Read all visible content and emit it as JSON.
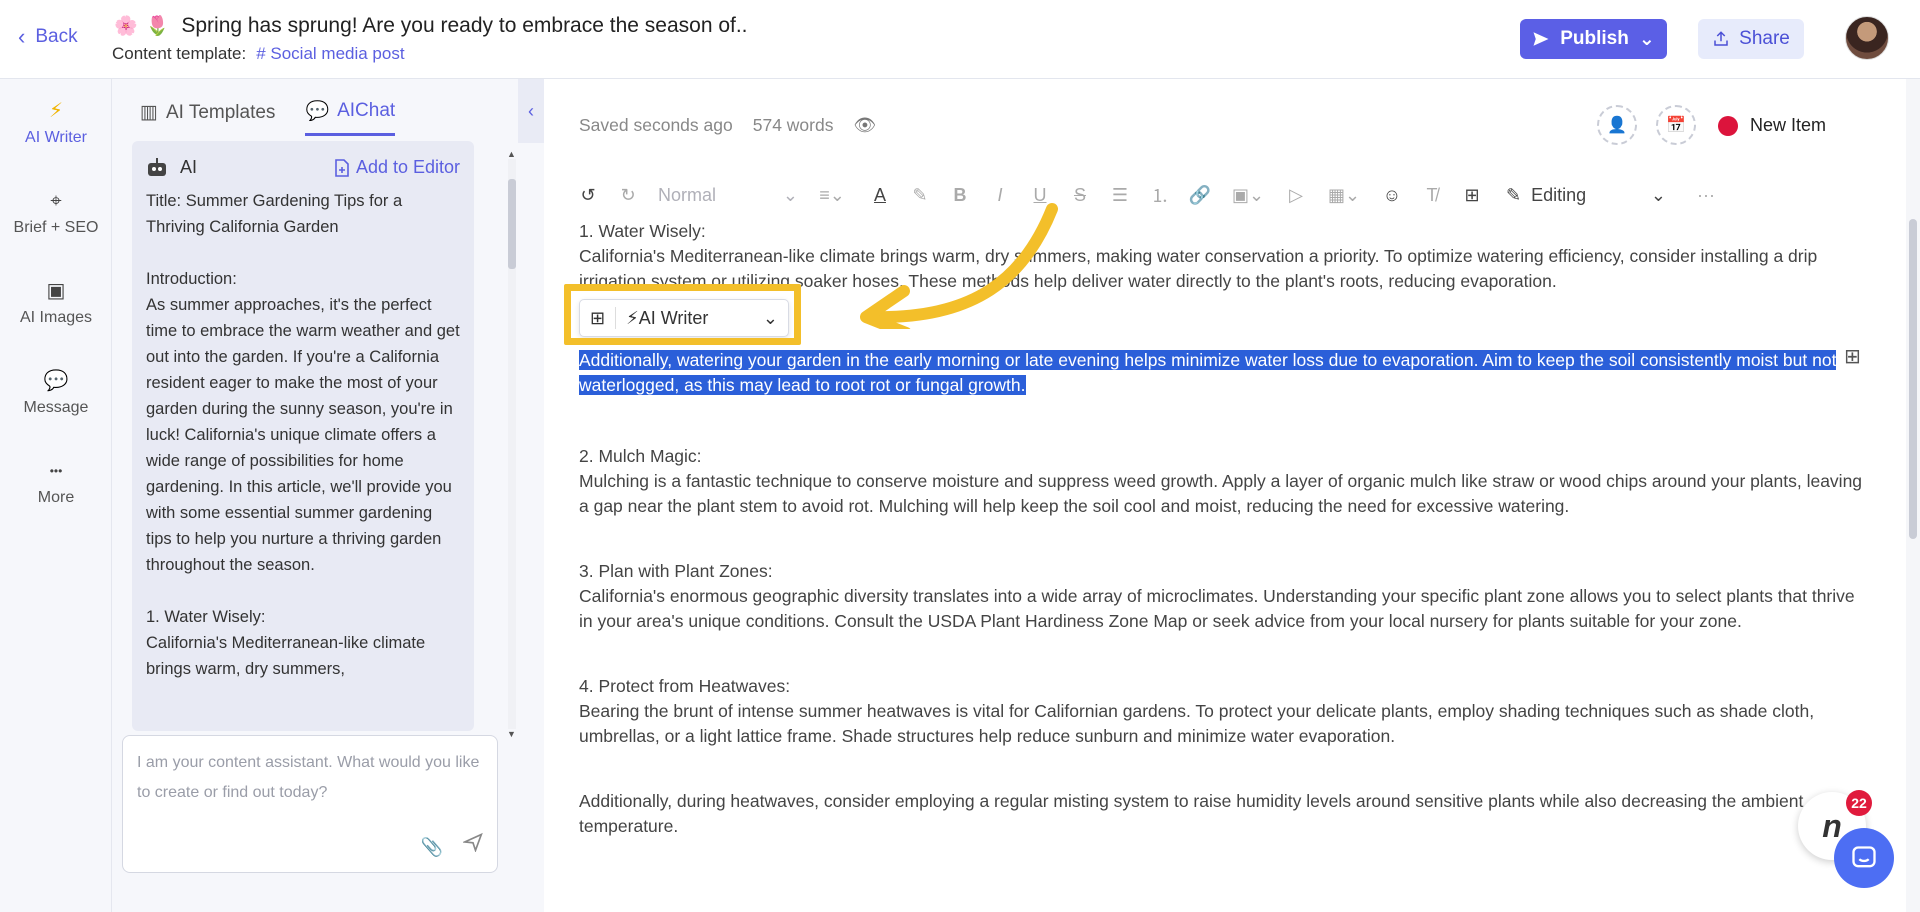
{
  "header": {
    "back_label": "Back",
    "emojis": [
      "🌸",
      "🌷"
    ],
    "title": "Spring has sprung! Are you ready to embrace the season of..",
    "template_label": "Content template:",
    "template_value": "# Social media post",
    "publish_label": "Publish",
    "share_label": "Share"
  },
  "leftnav": {
    "items": [
      {
        "label": "AI Writer",
        "icon": "⚡",
        "active": true
      },
      {
        "label": "Brief + SEO",
        "icon": "⌖"
      },
      {
        "label": "AI Images",
        "icon": "▣"
      },
      {
        "label": "Message",
        "icon": "💬"
      },
      {
        "label": "More",
        "icon": "•••"
      }
    ]
  },
  "panel": {
    "tabs": [
      {
        "label": "AI Templates",
        "icon": "▥"
      },
      {
        "label": "AIChat",
        "icon": "💬",
        "active": true
      }
    ],
    "chat": {
      "author": "AI",
      "add_to_editor": "Add to Editor",
      "text": "Title: Summer Gardening Tips for a Thriving California Garden\n\nIntroduction:\nAs summer approaches, it's the perfect time to embrace the warm weather and get out into the garden. If you're a California resident eager to make the most of your garden during the sunny season, you're in luck! California's unique climate offers a wide range of possibilities for home gardening. In this article, we'll provide you with some essential summer gardening tips to help you nurture a thriving garden throughout the season.\n\n1. Water Wisely:\nCalifornia's Mediterranean-like climate brings warm, dry summers,"
    },
    "input_placeholder": "I am your content assistant. What would you like to create or find out today?"
  },
  "editor": {
    "saved": "Saved seconds ago",
    "words": "574 words",
    "status": "New Item",
    "status_color": "#dc143c",
    "toolbar": {
      "style": "Normal",
      "mode": "Editing"
    },
    "inline_toolbar": {
      "label": "⚡AI Writer"
    },
    "sections": [
      {
        "heading": "1. Water Wisely:",
        "paras": [
          "California's Mediterranean-like climate brings warm, dry summers, making water conservation a priority. To optimize watering efficiency, consider installing a drip irrigation system or utilizing soaker hoses. These methods help deliver water directly to the plant's roots, reducing evaporation."
        ]
      },
      {
        "heading": "",
        "selected": "Additionally, watering your garden in the early morning or late evening helps minimize water loss due to evaporation. Aim to keep the soil consistently moist but not waterlogged, as this may lead to root rot or fungal growth."
      },
      {
        "heading": "2. Mulch Magic:",
        "paras": [
          "Mulching is a fantastic technique to conserve moisture and suppress weed growth. Apply a layer of organic mulch like straw or wood chips around your plants, leaving a gap near the plant stem to avoid rot. Mulching will help keep the soil cool and moist, reducing the need for excessive watering."
        ]
      },
      {
        "heading": "3. Plan with Plant Zones:",
        "paras": [
          "California's enormous geographic diversity translates into a wide array of microclimates. Understanding your specific plant zone allows you to select plants that thrive in your area's unique conditions. Consult the USDA Plant Hardiness Zone Map or seek advice from your local nursery for plants suitable for your zone."
        ]
      },
      {
        "heading": "4. Protect from Heatwaves:",
        "paras": [
          "Bearing the brunt of intense summer heatwaves is vital for Californian gardens. To protect your delicate plants, employ shading techniques such as shade cloth, umbrellas, or a light lattice frame. Shade structures help reduce sunburn and minimize water evaporation."
        ]
      },
      {
        "heading": "",
        "paras": [
          "Additionally, during heatwaves, consider employing a regular misting system to raise humidity levels around sensitive plants while also decreasing the ambient temperature."
        ]
      }
    ]
  },
  "notification_badge": "22",
  "highlight_color": "#f3bf2a",
  "selection_color": "#2b5fd9"
}
